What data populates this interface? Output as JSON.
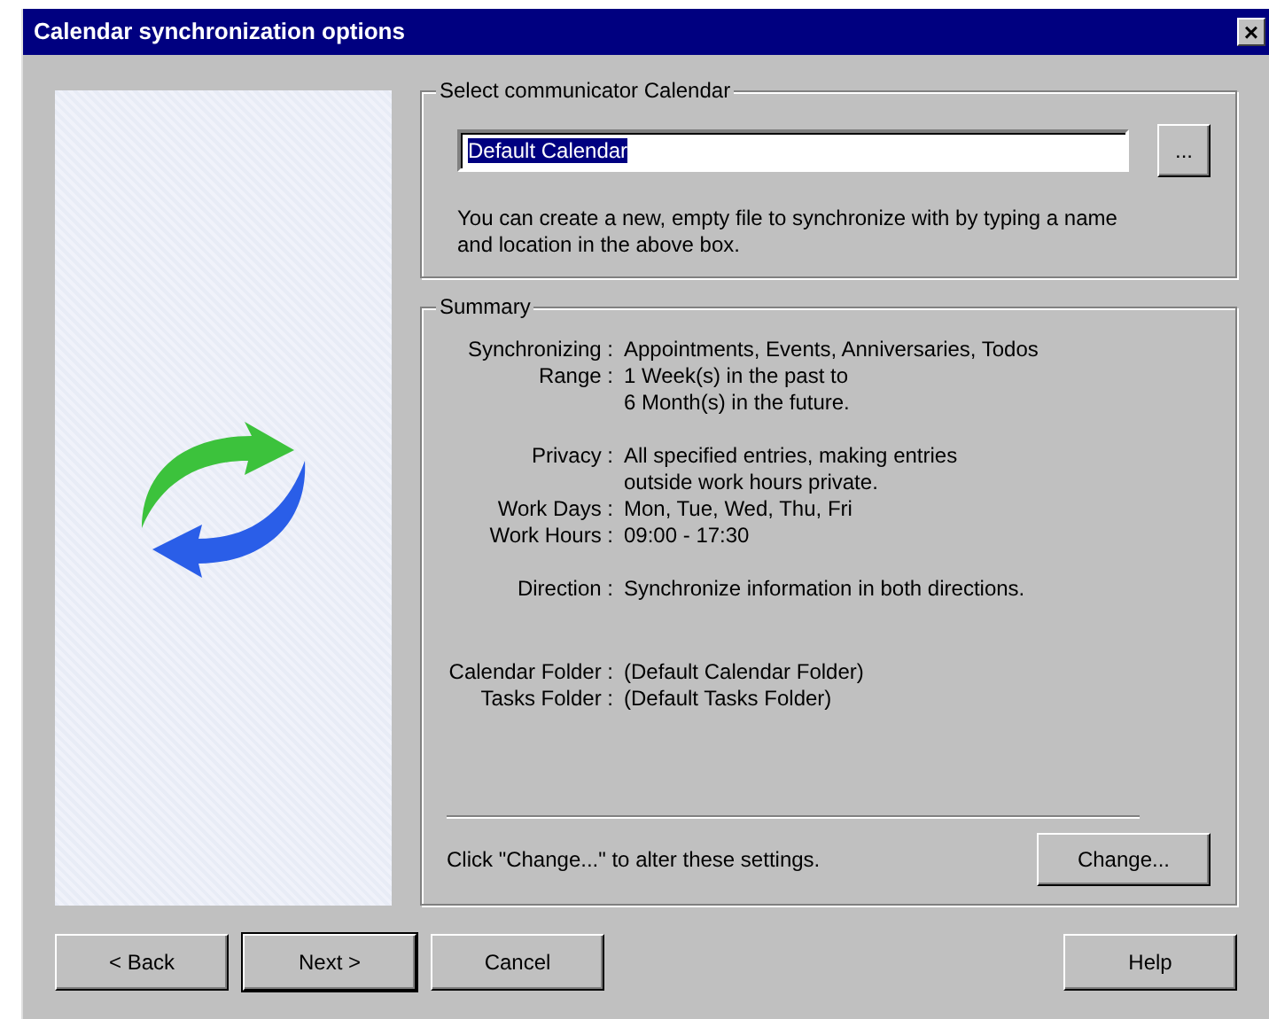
{
  "window": {
    "title": "Calendar synchronization options",
    "close": "×"
  },
  "calendar_group": {
    "title": "Select communicator Calendar",
    "field": {
      "value": "Default Calendar",
      "selected": true
    },
    "browse_button": "...",
    "hint": "You can create a new, empty file to synchronize with by typing a name and location in the above box."
  },
  "summary": {
    "title": "Summary",
    "groups": [
      [
        {
          "label": "Synchronizing :",
          "lines": [
            "Appointments, Events, Anniversaries, Todos"
          ]
        },
        {
          "label": "Range :",
          "lines": [
            "1 Week(s) in the past to",
            "6 Month(s) in the future."
          ]
        }
      ],
      [
        {
          "label": "Privacy :",
          "lines": [
            "All specified entries, making entries",
            "outside work hours private."
          ]
        },
        {
          "label": "Work Days :",
          "lines": [
            "Mon, Tue, Wed, Thu, Fri"
          ]
        },
        {
          "label": "Work Hours :",
          "lines": [
            "09:00 - 17:30"
          ]
        }
      ],
      [
        {
          "label": "Direction :",
          "lines": [
            "Synchronize information in both directions."
          ]
        }
      ],
      [
        {
          "label": "Calendar Folder :",
          "lines": [
            "(Default Calendar Folder)"
          ]
        },
        {
          "label": "Tasks Folder :",
          "lines": [
            "(Default Tasks Folder)"
          ]
        }
      ]
    ],
    "note": "Click \"Change...\" to alter these settings.",
    "change_button": "Change..."
  },
  "left_buttons": [
    {
      "label": "< Back",
      "default": false
    },
    {
      "label": "Next >",
      "default": true
    },
    {
      "label": "Cancel",
      "default": false
    }
  ],
  "right_buttons": [
    {
      "label": "Help",
      "default": false
    }
  ]
}
